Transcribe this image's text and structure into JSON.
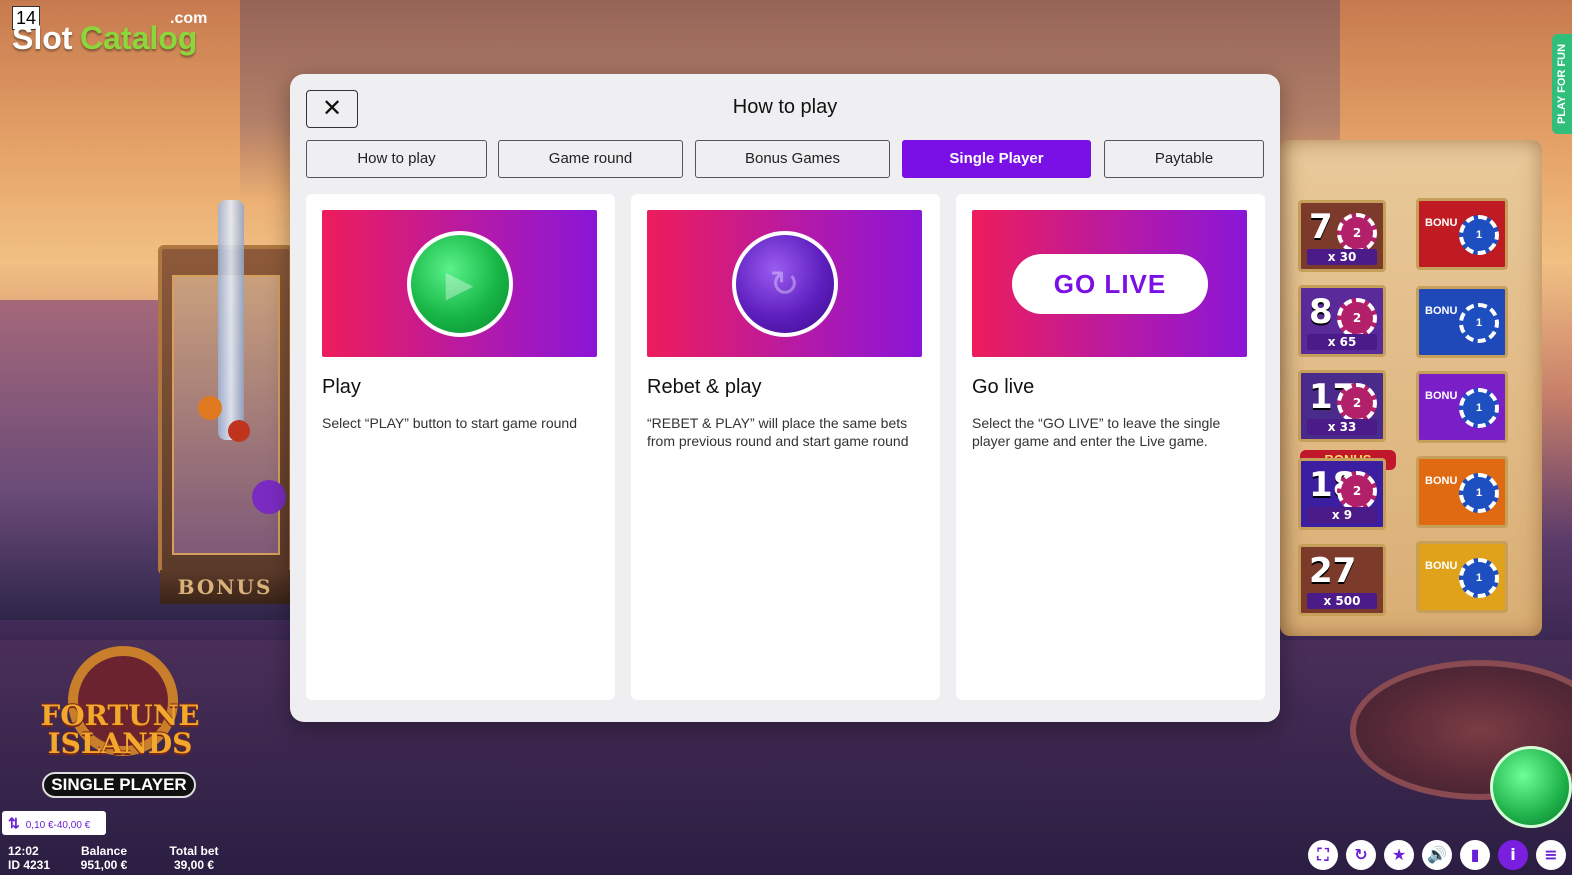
{
  "brand": {
    "frame_number": "14",
    "slot": "Slot",
    "catalog": "Catalog",
    "com": ".com"
  },
  "side_tab": {
    "label": "PLAY FOR FUN"
  },
  "background": {
    "bonus_plate": "BONUS"
  },
  "reels": {
    "number_tiles": [
      {
        "number": "7",
        "multiplier": "x 30",
        "chip": "2",
        "color": "#7b3a2a"
      },
      {
        "number": "8",
        "multiplier": "x 65",
        "chip": "2",
        "color": "#5a2a9a"
      },
      {
        "number": "17",
        "multiplier": "x 33",
        "chip": "2",
        "color": "#4a2a8a"
      },
      {
        "number": "18",
        "multiplier": "x 9",
        "chip": "2",
        "color": "#3b1fa0"
      },
      {
        "number": "27",
        "multiplier": "x 500",
        "chip": "",
        "color": "#7b3a2a"
      }
    ],
    "bonus_banner": "BONUS",
    "bonus_tiles": [
      {
        "label": "BONU",
        "chip": "1",
        "color": "#c01b22"
      },
      {
        "label": "BONU",
        "chip": "1",
        "color": "#1f49b8"
      },
      {
        "label": "BONU",
        "chip": "1",
        "color": "#7a1fc7"
      },
      {
        "label": "BONU",
        "chip": "1",
        "color": "#e06a12"
      },
      {
        "label": "BONU",
        "chip": "1",
        "color": "#e0a21a"
      }
    ]
  },
  "game_logo": {
    "line1": "FORTUNE",
    "line2": "ISLANDS",
    "badge": "SINGLE PLAYER"
  },
  "footer": {
    "bet_range": "0,10 €-40,00 €",
    "time": "12:02",
    "id": "ID 4231",
    "balance_label": "Balance",
    "balance_value": "951,00 €",
    "total_bet_label": "Total bet",
    "total_bet_value": "39,00 €"
  },
  "toolbar_icons": [
    "fullscreen-icon",
    "autoplay-icon",
    "favorite-icon",
    "sound-icon",
    "stats-icon",
    "info-icon",
    "menu-icon"
  ],
  "modal": {
    "close_label": "✕",
    "title": "How to play",
    "tabs": [
      "How to play",
      "Game round",
      "Bonus Games",
      "Single Player",
      "Paytable"
    ],
    "active_tab": "Single Player",
    "cards": [
      {
        "heading": "Play",
        "text": "Select “PLAY” button to start game round"
      },
      {
        "heading": "Rebet & play",
        "text": "“REBET & PLAY” will place the same bets from previous round and start game round"
      },
      {
        "heading": "Go live",
        "text": "Select the “GO LIVE” to leave the single player game and enter the Live game.",
        "button_label": "GO LIVE"
      }
    ]
  },
  "colors": {
    "accent": "#7a10e6",
    "banner_start": "#ee1c5b",
    "banner_end": "#8a16d8",
    "spin_green": "#1fb14a"
  }
}
